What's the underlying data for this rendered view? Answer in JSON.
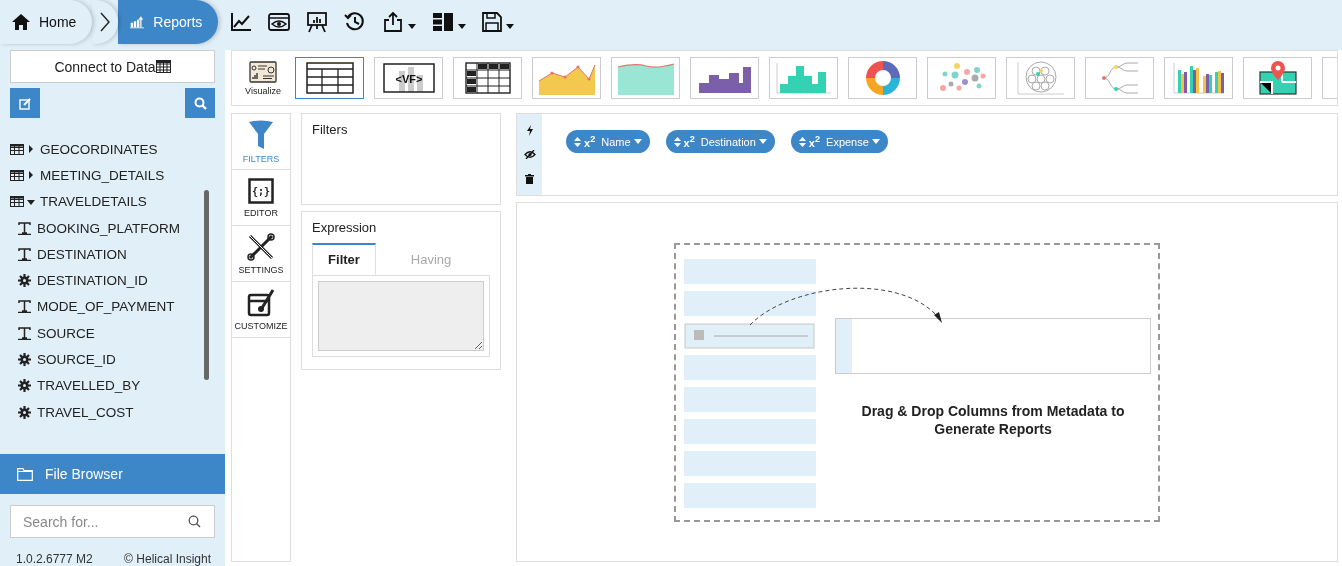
{
  "breadcrumb": [
    {
      "label": "Home",
      "kind": "home",
      "selected": false
    },
    {
      "label": "Reports",
      "kind": "reports",
      "selected": true
    }
  ],
  "toolbar": [
    {
      "kind": "chart",
      "dropdown": false
    },
    {
      "kind": "preview",
      "dropdown": false
    },
    {
      "kind": "present",
      "dropdown": false
    },
    {
      "kind": "history",
      "dropdown": false
    },
    {
      "kind": "export",
      "dropdown": true
    },
    {
      "kind": "layout",
      "dropdown": true
    },
    {
      "kind": "save",
      "dropdown": true
    }
  ],
  "sidebar": {
    "connect_button": "Connect to Data",
    "tree": [
      {
        "label": "GEOCORDINATES",
        "kind": "table",
        "expanded": false
      },
      {
        "label": "MEETING_DETAILS",
        "kind": "table",
        "expanded": false
      },
      {
        "label": "TRAVELDETAILS",
        "kind": "table",
        "expanded": true,
        "children": [
          {
            "label": "BOOKING_PLATFORM",
            "kind": "text"
          },
          {
            "label": "DESTINATION",
            "kind": "text"
          },
          {
            "label": "DESTINATION_ID",
            "kind": "number"
          },
          {
            "label": "MODE_OF_PAYMENT",
            "kind": "text"
          },
          {
            "label": "SOURCE",
            "kind": "text"
          },
          {
            "label": "SOURCE_ID",
            "kind": "number"
          },
          {
            "label": "TRAVELLED_BY",
            "kind": "number"
          },
          {
            "label": "TRAVEL_COST",
            "kind": "number"
          }
        ]
      }
    ],
    "file_browser": "File Browser",
    "search": {
      "placeholder": "Search for..."
    },
    "version": "1.0.2.6777 M2",
    "copyright": "© Helical Insight"
  },
  "visualize": {
    "label": "Visualize",
    "types": [
      {
        "kind": "table",
        "selected": true
      },
      {
        "kind": "vf",
        "label": "<VF>",
        "selected": false
      },
      {
        "kind": "crosstab",
        "selected": false
      },
      {
        "kind": "line-area",
        "selected": false
      },
      {
        "kind": "area",
        "selected": false
      },
      {
        "kind": "step",
        "selected": false
      },
      {
        "kind": "histogram",
        "selected": false
      },
      {
        "kind": "donut",
        "selected": false
      },
      {
        "kind": "bubble",
        "selected": false
      },
      {
        "kind": "pack",
        "selected": false
      },
      {
        "kind": "tree",
        "selected": false
      },
      {
        "kind": "grouped-bar",
        "selected": false
      },
      {
        "kind": "map",
        "selected": false
      },
      {
        "kind": "other",
        "selected": false
      }
    ]
  },
  "side_tabs": [
    {
      "label": "FILTERS",
      "kind": "filters",
      "selected": true
    },
    {
      "label": "EDITOR",
      "kind": "editor",
      "glyph": "{;}",
      "selected": false
    },
    {
      "label": "SETTINGS",
      "kind": "settings",
      "selected": false
    },
    {
      "label": "CUSTOMIZE",
      "kind": "customize",
      "selected": false
    }
  ],
  "filters_panel": {
    "title": "Filters"
  },
  "expression_panel": {
    "title": "Expression",
    "tabs": [
      {
        "label": "Filter",
        "selected": true
      },
      {
        "label": "Having",
        "selected": false
      }
    ]
  },
  "fields": [
    {
      "badge": "x$^{2}$",
      "label": "Name"
    },
    {
      "badge": "x$^{2}$",
      "label": "Destination"
    },
    {
      "badge": "x$^{2}$",
      "label": "Expense"
    }
  ],
  "canvas": {
    "message": "Drag & Drop Columns from Metadata to Generate Reports"
  }
}
